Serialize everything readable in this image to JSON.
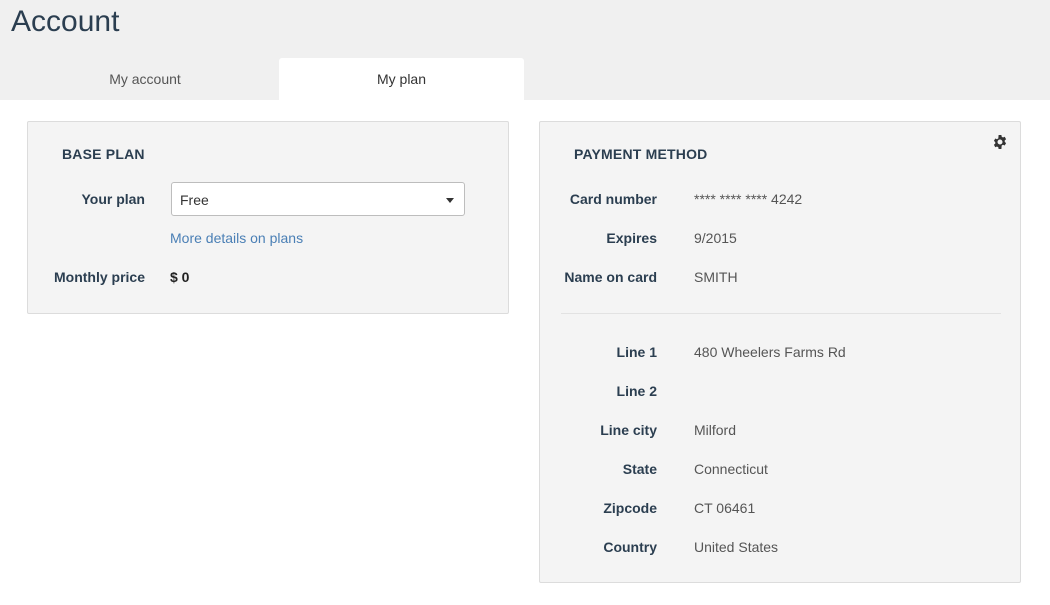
{
  "page": {
    "title": "Account"
  },
  "tabs": [
    {
      "label": "My account",
      "active": false
    },
    {
      "label": "My plan",
      "active": true
    }
  ],
  "base_plan": {
    "title": "BASE PLAN",
    "your_plan_label": "Your plan",
    "plan_value": "Free",
    "details_link": "More details on plans",
    "monthly_price_label": "Monthly price",
    "monthly_price_value": "$ 0"
  },
  "payment": {
    "title": "PAYMENT METHOD",
    "settings_icon": "gear-icon",
    "card_number_label": "Card number",
    "card_number_value": "**** **** **** 4242",
    "expires_label": "Expires",
    "expires_value": "9/2015",
    "name_label": "Name on card",
    "name_value": "SMITH",
    "line1_label": "Line 1",
    "line1_value": "480 Wheelers Farms Rd",
    "line2_label": "Line 2",
    "line2_value": "",
    "city_label": "Line city",
    "city_value": "Milford",
    "state_label": "State",
    "state_value": "Connecticut",
    "zip_label": "Zipcode",
    "zip_value": "CT 06461",
    "country_label": "Country",
    "country_value": "United States"
  },
  "colors": {
    "heading": "#2b3e50",
    "link": "#4a7fb5",
    "header_bg": "#f0f0f0",
    "card_bg": "#f4f4f4"
  }
}
